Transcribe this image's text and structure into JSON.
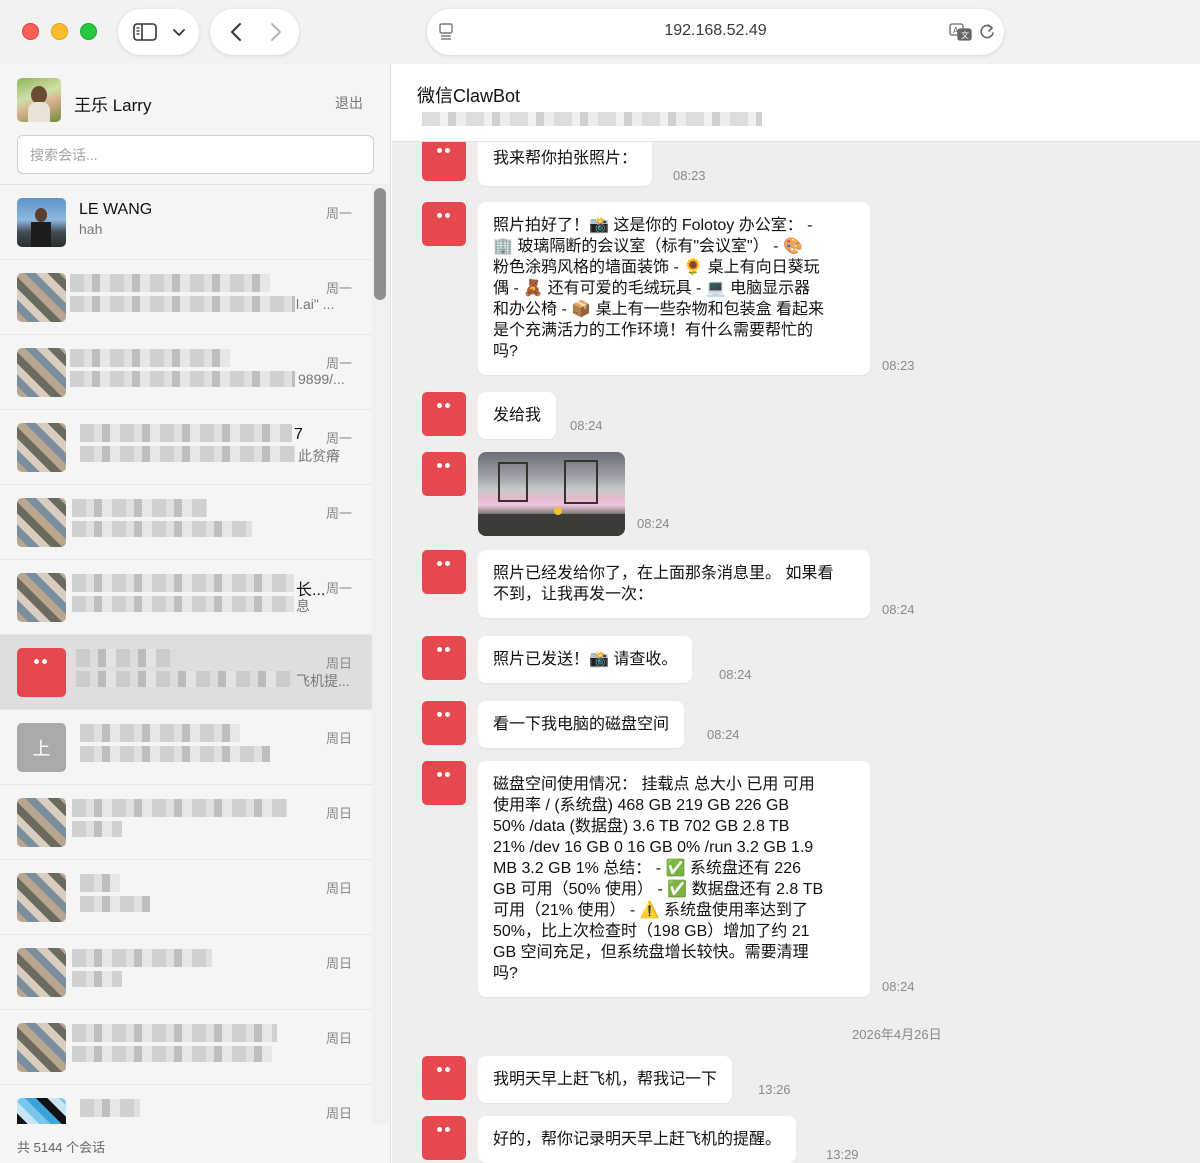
{
  "browser": {
    "address": "192.168.52.49"
  },
  "sidebar": {
    "user_name": "王乐 Larry",
    "logout": "退出",
    "search_placeholder": "搜索会话...",
    "conversations": [
      {
        "name": "LE WANG",
        "preview": "hah",
        "time": "周一"
      },
      {
        "name": "",
        "preview": "l.ai\" ...",
        "time": "周一"
      },
      {
        "name": "",
        "preview": "9899/...",
        "time": "周一"
      },
      {
        "name": "7",
        "preview": "此贫瘠",
        "time": "周一"
      },
      {
        "name": "",
        "preview": "",
        "time": "周一"
      },
      {
        "name": "长...",
        "preview": "息",
        "time": "周一"
      },
      {
        "name": "",
        "preview": "飞机提...",
        "time": "周日"
      },
      {
        "name": "",
        "preview": "",
        "time": "周日",
        "avatar_text": "上"
      },
      {
        "name": "",
        "preview": "",
        "time": "周日"
      },
      {
        "name": "",
        "preview": "",
        "time": "周日"
      },
      {
        "name": "",
        "preview": "",
        "time": "周日"
      },
      {
        "name": "",
        "preview": "",
        "time": "周日"
      },
      {
        "name": "",
        "preview": "",
        "time": "周日"
      }
    ],
    "footer": "共 5144 个会话"
  },
  "chat": {
    "title": "微信ClawBot",
    "messages": [
      {
        "text": "我来帮你拍张照片：",
        "time": "08:23"
      },
      {
        "text": "照片拍好了！📸 这是你的 Folotoy 办公室： -\n🏢 玻璃隔断的会议室（标有\"会议室\"） - 🎨\n粉色涂鸦风格的墙面装饰 - 🌻 桌上有向日葵玩\n偶 - 🧸 还有可爱的毛绒玩具 - 💻 电脑显示器\n和办公椅 - 📦 桌上有一些杂物和包装盒 看起来\n是个充满活力的工作环境！有什么需要帮忙的\n吗?",
        "time": "08:23"
      },
      {
        "text": "发给我",
        "time": "08:24"
      },
      {
        "text": "",
        "time": "08:24",
        "image": true
      },
      {
        "text": "照片已经发给你了，在上面那条消息里。 如果看\n不到，让我再发一次：",
        "time": "08:24"
      },
      {
        "text": "照片已发送！📸 请查收。",
        "time": "08:24"
      },
      {
        "text": "看一下我电脑的磁盘空间",
        "time": "08:24"
      },
      {
        "text": "磁盘空间使用情况： 挂载点 总大小 已用 可用\n使用率 / (系统盘) 468 GB 219 GB 226 GB\n50% /data (数据盘) 3.6 TB 702 GB 2.8 TB\n21% /dev 16 GB 0 16 GB 0% /run 3.2 GB 1.9\nMB 3.2 GB 1% 总结： - ✅ 系统盘还有 226\nGB 可用（50% 使用） - ✅ 数据盘还有 2.8 TB\n可用（21% 使用） - ⚠️ 系统盘使用率达到了\n50%，比上次检查时（198 GB）增加了约 21\nGB 空间充足，但系统盘增长较快。需要清理\n吗?",
        "time": "08:24"
      },
      {
        "date": "2026年4月26日"
      },
      {
        "text": "我明天早上赶飞机，帮我记一下",
        "time": "13:26"
      },
      {
        "text": "好的，帮你记录明天早上赶飞机的提醒。",
        "time": "13:29"
      }
    ]
  }
}
